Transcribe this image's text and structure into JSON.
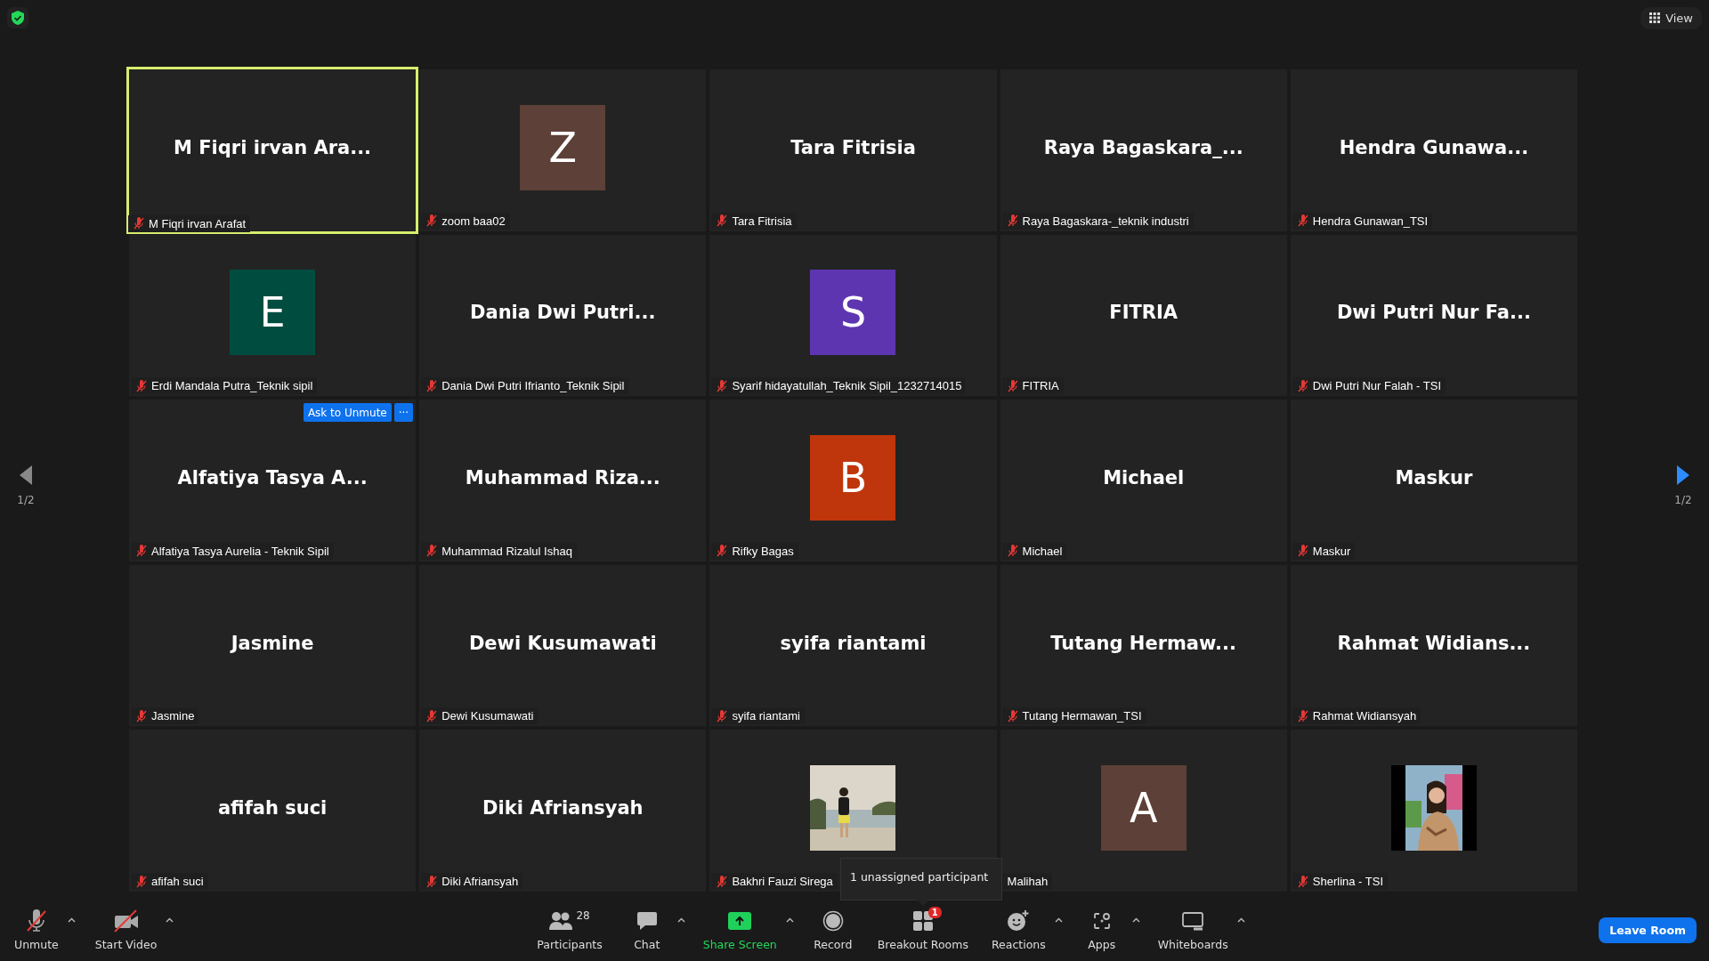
{
  "top_bar": {
    "view_button": "View"
  },
  "pager": {
    "prev": {
      "label": "1/2",
      "enabled": false
    },
    "next": {
      "label": "1/2",
      "enabled": true
    }
  },
  "tiles": [
    {
      "kind": "name",
      "display": "M Fiqri irvan Ara...",
      "label": "M Fiqri irvan Arafat",
      "muted": true,
      "active_speaker": true
    },
    {
      "kind": "avatar",
      "display": "Z",
      "color": "#5d4037",
      "label": "zoom baa02",
      "muted": true,
      "active_speaker": false
    },
    {
      "kind": "name",
      "display": "Tara Fitrisia",
      "label": "Tara Fitrisia",
      "muted": true,
      "active_speaker": false
    },
    {
      "kind": "name",
      "display": "Raya Bagaskara_...",
      "label": "Raya Bagaskara-_teknik industri",
      "muted": true,
      "active_speaker": false
    },
    {
      "kind": "name",
      "display": "Hendra Gunawa...",
      "label": "Hendra Gunawan_TSI",
      "muted": true,
      "active_speaker": false
    },
    {
      "kind": "avatar",
      "display": "E",
      "color": "#004d40",
      "label": "Erdi Mandala Putra_Teknik sipil",
      "muted": true,
      "active_speaker": false
    },
    {
      "kind": "name",
      "display": "Dania Dwi Putri...",
      "label": "Dania Dwi Putri Ifrianto_Teknik Sipil",
      "muted": true,
      "active_speaker": false
    },
    {
      "kind": "avatar",
      "display": "S",
      "color": "#5e35b1",
      "label": "Syarif hidayatullah_Teknik Sipil_1232714015",
      "muted": true,
      "active_speaker": false
    },
    {
      "kind": "name",
      "display": "FITRIA",
      "label": "FITRIA",
      "muted": true,
      "active_speaker": false
    },
    {
      "kind": "name",
      "display": "Dwi Putri Nur Fa...",
      "label": "Dwi Putri Nur Falah - TSI",
      "muted": true,
      "active_speaker": false
    },
    {
      "kind": "name",
      "display": "Alfatiya Tasya A...",
      "label": "Alfatiya Tasya Aurelia - Teknik Sipil",
      "muted": true,
      "active_speaker": false,
      "actions": {
        "ask": "Ask to Unmute",
        "more": "···"
      }
    },
    {
      "kind": "name",
      "display": "Muhammad Riza...",
      "label": "Muhammad Rizalul Ishaq",
      "muted": true,
      "active_speaker": false
    },
    {
      "kind": "avatar",
      "display": "B",
      "color": "#bf360c",
      "label": "Rifky Bagas",
      "muted": true,
      "active_speaker": false
    },
    {
      "kind": "name",
      "display": "Michael",
      "label": "Michael",
      "muted": true,
      "active_speaker": false
    },
    {
      "kind": "name",
      "display": "Maskur",
      "label": "Maskur",
      "muted": true,
      "active_speaker": false
    },
    {
      "kind": "name",
      "display": "Jasmine",
      "label": "Jasmine",
      "muted": true,
      "active_speaker": false
    },
    {
      "kind": "name",
      "display": "Dewi Kusumawati",
      "label": "Dewi Kusumawati",
      "muted": true,
      "active_speaker": false
    },
    {
      "kind": "name",
      "display": "syifa riantami",
      "label": "syifa riantami",
      "muted": true,
      "active_speaker": false
    },
    {
      "kind": "name",
      "display": "Tutang Hermaw...",
      "label": "Tutang Hermawan_TSI",
      "muted": true,
      "active_speaker": false
    },
    {
      "kind": "name",
      "display": "Rahmat Widians...",
      "label": "Rahmat Widiansyah",
      "muted": true,
      "active_speaker": false
    },
    {
      "kind": "name",
      "display": "afifah suci",
      "label": "afifah suci",
      "muted": true,
      "active_speaker": false
    },
    {
      "kind": "name",
      "display": "Diki Afriansyah",
      "label": "Diki Afriansyah",
      "muted": true,
      "active_speaker": false
    },
    {
      "kind": "picture",
      "label": "Bakhri Fauzi Sirega",
      "muted": true,
      "active_speaker": false
    },
    {
      "kind": "avatar",
      "display": "A",
      "color": "#5d4037",
      "label": "Malihah",
      "muted": false,
      "active_speaker": false
    },
    {
      "kind": "picture",
      "label": "Sherlina - TSI",
      "muted": true,
      "active_speaker": false
    }
  ],
  "toolbar": {
    "left": [
      {
        "kind": "mic",
        "label": "Unmute",
        "menu": true
      },
      {
        "kind": "video",
        "label": "Start Video",
        "menu": true
      }
    ],
    "center": [
      {
        "kind": "participants",
        "label": "Participants",
        "count": "28",
        "menu": false
      },
      {
        "kind": "chat",
        "label": "Chat",
        "menu": true
      },
      {
        "kind": "share",
        "label": "Share Screen",
        "menu": true
      },
      {
        "kind": "record",
        "label": "Record",
        "menu": false
      },
      {
        "kind": "breakout",
        "label": "Breakout Rooms",
        "badge": "1",
        "menu": false
      },
      {
        "kind": "reactions",
        "label": "Reactions",
        "menu": true
      },
      {
        "kind": "apps",
        "label": "Apps",
        "menu": true
      },
      {
        "kind": "whiteboards",
        "label": "Whiteboards",
        "menu": true
      }
    ],
    "leave_button": "Leave Room"
  },
  "tooltip": "1 unassigned participant"
}
